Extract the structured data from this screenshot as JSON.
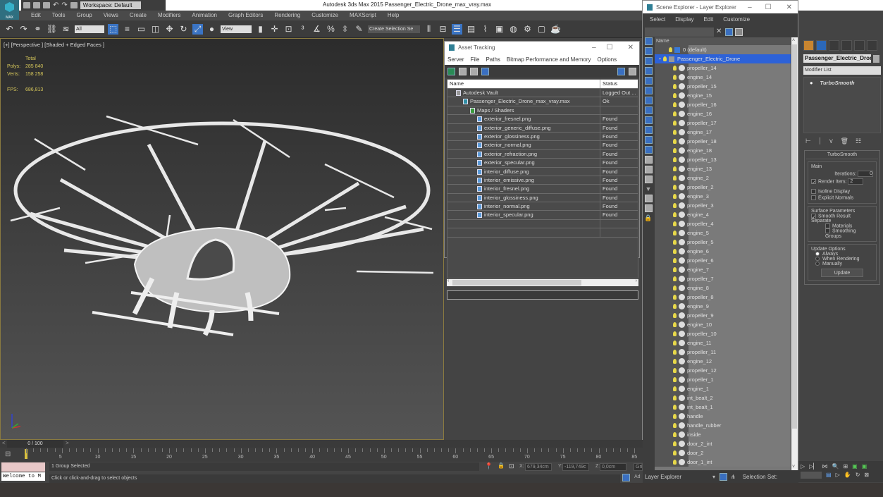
{
  "app": {
    "title": "Autodesk 3ds Max  2015    Passenger_Electric_Drone_max_vray.max",
    "logo_label": "MAX",
    "workspace": "Workspace: Default"
  },
  "menubar": [
    "Edit",
    "Tools",
    "Group",
    "Views",
    "Create",
    "Modifiers",
    "Animation",
    "Graph Editors",
    "Rendering",
    "Customize",
    "MAXScript",
    "Help"
  ],
  "toolbar": {
    "selection_filter": "All",
    "ref_coord": "View",
    "named_selection": "Create Selection Se"
  },
  "viewport": {
    "label": "[+] [Perspective ] [Shaded + Edged Faces ]",
    "stats_header": "Total",
    "polys_label": "Polys:",
    "polys_value": "285 840",
    "verts_label": "Verts:",
    "verts_value": "158 258",
    "fps_label": "FPS:",
    "fps_value": "686,813"
  },
  "asset_tracking": {
    "title": "Asset Tracking",
    "menu": [
      "Server",
      "File",
      "Paths",
      "Bitmap Performance and Memory",
      "Options"
    ],
    "columns": [
      "Name",
      "Status"
    ],
    "rows": [
      {
        "name": "Autodesk Vault",
        "status": "Logged Out ...",
        "indent": 1,
        "icon": "vault-icon"
      },
      {
        "name": "Passenger_Electric_Drone_max_vray.max",
        "status": "Ok",
        "indent": 2,
        "icon": "max-file-icon"
      },
      {
        "name": "Maps / Shaders",
        "status": "",
        "indent": 3,
        "icon": "maps-icon"
      },
      {
        "name": "exterior_fresnel.png",
        "status": "Found",
        "indent": 4,
        "icon": "image-file-icon"
      },
      {
        "name": "exterior_generic_diffuse.png",
        "status": "Found",
        "indent": 4,
        "icon": "image-file-icon"
      },
      {
        "name": "exterior_glossiness.png",
        "status": "Found",
        "indent": 4,
        "icon": "image-file-icon"
      },
      {
        "name": "exterior_normal.png",
        "status": "Found",
        "indent": 4,
        "icon": "image-file-icon"
      },
      {
        "name": "exterior_refraction.png",
        "status": "Found",
        "indent": 4,
        "icon": "image-file-icon"
      },
      {
        "name": "exterior_specular.png",
        "status": "Found",
        "indent": 4,
        "icon": "image-file-icon"
      },
      {
        "name": "interior_diffuse.png",
        "status": "Found",
        "indent": 4,
        "icon": "image-file-icon"
      },
      {
        "name": "interior_emissive.png",
        "status": "Found",
        "indent": 4,
        "icon": "image-file-icon"
      },
      {
        "name": "interior_fresnel.png",
        "status": "Found",
        "indent": 4,
        "icon": "image-file-icon"
      },
      {
        "name": "interior_glossiness.png",
        "status": "Found",
        "indent": 4,
        "icon": "image-file-icon"
      },
      {
        "name": "interior_normal.png",
        "status": "Found",
        "indent": 4,
        "icon": "image-file-icon"
      },
      {
        "name": "interior_specular.png",
        "status": "Found",
        "indent": 4,
        "icon": "image-file-icon"
      }
    ]
  },
  "scene_explorer": {
    "title": "Scene Explorer - Layer Explorer",
    "menu": [
      "Select",
      "Display",
      "Edit",
      "Customize"
    ],
    "column": "Name",
    "layers": [
      {
        "name": "0 (default)",
        "type": "layer"
      },
      {
        "name": "Passenger_Electric_Drone",
        "type": "layer",
        "selected": true
      }
    ],
    "objects": [
      "propeller_14",
      "engine_14",
      "propeller_15",
      "engine_15",
      "propeller_16",
      "engine_16",
      "propeller_17",
      "engine_17",
      "propeller_18",
      "engine_18",
      "propeller_13",
      "engine_13",
      "engine_2",
      "propeller_2",
      "engine_3",
      "propeller_3",
      "engine_4",
      "propeller_4",
      "engine_5",
      "propeller_5",
      "engine_6",
      "propeller_6",
      "engine_7",
      "propeller_7",
      "engine_8",
      "propeller_8",
      "engine_9",
      "propeller_9",
      "engine_10",
      "propeller_10",
      "engine_11",
      "propeller_11",
      "engine_12",
      "propeller_12",
      "propeller_1",
      "engine_1",
      "int_bealt_2",
      "int_bealt_1",
      "handle",
      "handle_rubber",
      "inside",
      "door_2_int",
      "door_2",
      "door_1_int"
    ],
    "explorer_dropdown": "Layer Explorer",
    "selection_set_label": "Selection Set:"
  },
  "command_panel": {
    "object_name": "Passenger_Electric_Dron",
    "modifier_list": "Modifier List",
    "stack_item": "TurboSmooth",
    "rollout_title": "TurboSmooth",
    "main_group": "Main",
    "iterations_label": "Iterations:",
    "iterations_value": "0",
    "render_iters_label": "Render Iters:",
    "render_iters_value": "2",
    "render_iters_checked": true,
    "isoline_label": "Isoline Display",
    "isoline_checked": false,
    "explicit_normals_label": "Explicit Normals",
    "explicit_normals_checked": false,
    "surface_group": "Surface Parameters",
    "smooth_result_label": "Smooth Result",
    "smooth_result_checked": true,
    "separate_label": "Separate",
    "materials_label": "Materials",
    "smoothing_groups_label": "Smoothing Groups",
    "update_group": "Update Options",
    "update_options": [
      "Always",
      "When Rendering",
      "Manually"
    ],
    "update_selected": "Always",
    "update_button": "Update"
  },
  "timeline": {
    "frame_display": "0 / 100",
    "current_frame": 0,
    "ticks": [
      5,
      10,
      15,
      20,
      25,
      30,
      35,
      40,
      45,
      50,
      55,
      60,
      65,
      70,
      75,
      80,
      85
    ]
  },
  "status": {
    "maxscript_listener": "Welcome to M",
    "selection_status": "1 Group Selected",
    "prompt": "Click or click-and-drag to select objects",
    "x_label": "X:",
    "x_value": "679,34cm",
    "y_label": "Y:",
    "y_value": "-119,749c",
    "z_label": "Z:",
    "z_value": "0,0cm",
    "grid_label": "Gri",
    "add_label": "Ad"
  }
}
